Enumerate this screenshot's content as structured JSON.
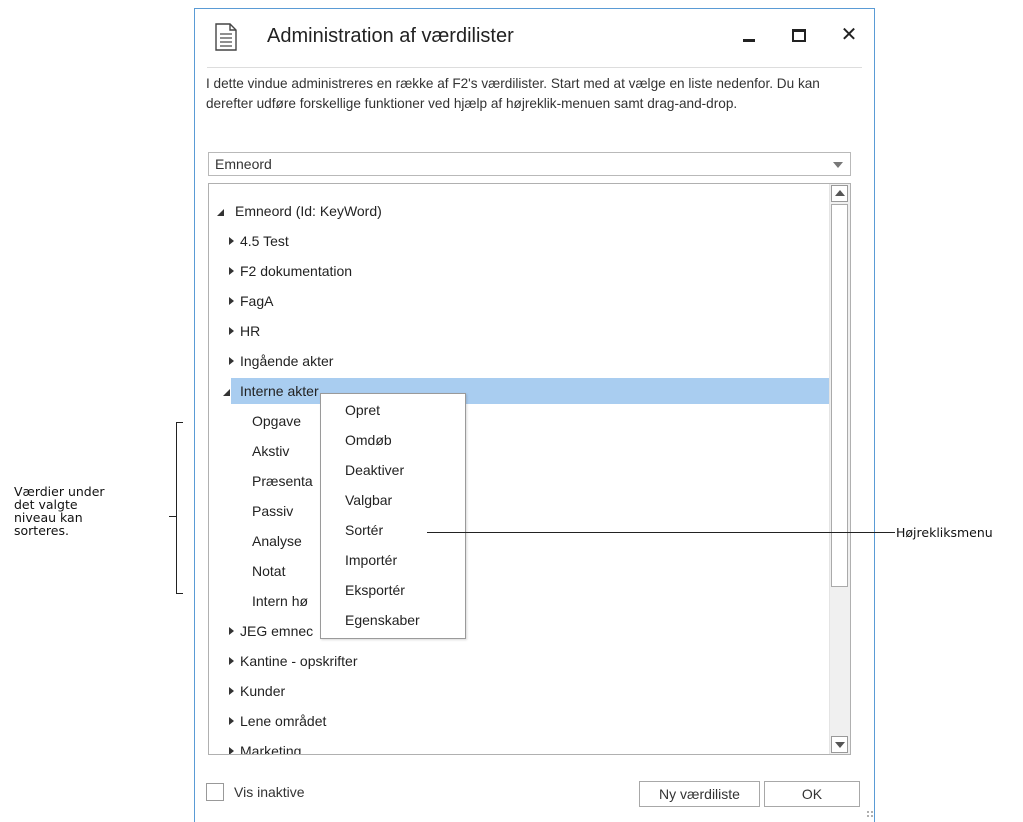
{
  "window": {
    "title": "Administration af værdilister",
    "close_glyph": "✕"
  },
  "description": "I dette vindue administreres en række af F2's værdilister. Start med at vælge en liste nedenfor. Du kan derefter udføre forskellige funktioner ved hjælp af højreklik-menuen samt drag-and-drop.",
  "combo": {
    "value": "Emneord"
  },
  "tree": {
    "items": [
      {
        "label": "Emneord (Id: KeyWord)",
        "level": 0,
        "expander": "open"
      },
      {
        "label": "4.5 Test",
        "level": 1,
        "expander": "closed"
      },
      {
        "label": "F2 dokumentation",
        "level": 1,
        "expander": "closed"
      },
      {
        "label": "FagA",
        "level": 1,
        "expander": "closed"
      },
      {
        "label": "HR",
        "level": 1,
        "expander": "closed"
      },
      {
        "label": "Ingående akter",
        "level": 1,
        "expander": "closed"
      },
      {
        "label": "Interne akter",
        "level": 1,
        "expander": "open",
        "selected": true
      },
      {
        "label": "Opgave",
        "level": 2,
        "expander": "none"
      },
      {
        "label": "Akstiv",
        "level": 2,
        "expander": "none"
      },
      {
        "label": "Præsenta",
        "level": 2,
        "expander": "none"
      },
      {
        "label": "Passiv",
        "level": 2,
        "expander": "none"
      },
      {
        "label": "Analyse",
        "level": 2,
        "expander": "none"
      },
      {
        "label": "Notat",
        "level": 2,
        "expander": "none"
      },
      {
        "label": "Intern hø",
        "level": 2,
        "expander": "none"
      },
      {
        "label": "JEG emnec",
        "level": 1,
        "expander": "closed"
      },
      {
        "label": "Kantine - opskrifter",
        "level": 1,
        "expander": "closed"
      },
      {
        "label": "Kunder",
        "level": 1,
        "expander": "closed"
      },
      {
        "label": "Lene området",
        "level": 1,
        "expander": "closed"
      },
      {
        "label": "Marketing",
        "level": 1,
        "expander": "closed"
      }
    ]
  },
  "context_menu": {
    "items": [
      "Opret",
      "Omdøb",
      "Deaktiver",
      "Valgbar",
      "Sortér",
      "Importér",
      "Eksportér",
      "Egenskaber"
    ]
  },
  "footer": {
    "show_inactive_label": "Vis inaktive",
    "show_inactive_checked": false,
    "new_list_button": "Ny værdiliste",
    "ok_button": "OK"
  },
  "annotations": {
    "left_lines": [
      "Værdier under",
      "det valgte",
      "niveau kan",
      "sorteres."
    ],
    "right": "Højrekliksmenu"
  },
  "colors": {
    "window_border": "#5a9bd5",
    "selection": "#a9cdf0"
  }
}
